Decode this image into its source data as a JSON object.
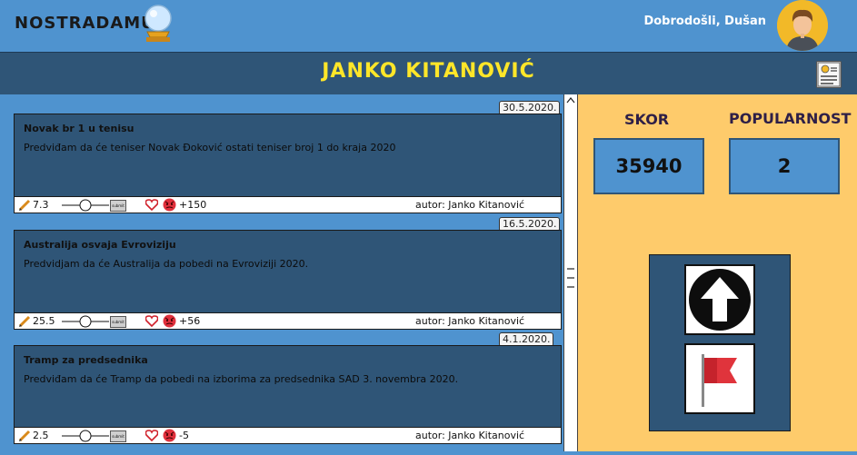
{
  "header": {
    "logo": "NOSTRADAMUS",
    "welcome": "Dobrodošli, Dušan"
  },
  "profile": {
    "name": "JANKO KITANOVIĆ"
  },
  "predictions": [
    {
      "date": "30.5.2020.",
      "title": "Novak br 1 u tenisu",
      "text": "Predviđam da će teniser Novak Đoković ostati teniser broj 1 do kraja 2020",
      "rating": "7.3",
      "vote_button": "submit",
      "score": "+150",
      "author": "autor: Janko Kitanović"
    },
    {
      "date": "16.5.2020.",
      "title": "Australija osvaja Evroviziju",
      "text": "Predvidjam da će Australija da pobedi na Evroviziji 2020.",
      "rating": "25.5",
      "vote_button": "submit",
      "score": "+56",
      "author": "autor: Janko Kitanović"
    },
    {
      "date": "4.1.2020.",
      "title": "Tramp za predsednika",
      "text": "Predviđam da će Tramp da pobedi na izborima za predsednika SAD 3. novembra 2020.",
      "rating": "2.5",
      "vote_button": "submit",
      "score": "-5",
      "author": "autor: Janko Kitanović"
    }
  ],
  "stats": {
    "score_label": "SKOR",
    "score_value": "35940",
    "popularity_label": "POPULARNOST",
    "popularity_value": "2"
  },
  "colors": {
    "background": "#4f93cf",
    "title_bar": "#2f5577",
    "title_text": "#ffe629",
    "side_panel": "#fecb6b"
  },
  "icons": [
    "crystal-ball-icon",
    "user-avatar-icon",
    "profile-document-icon",
    "pencil-icon",
    "heart-icon",
    "angry-face-icon",
    "arrow-up-icon",
    "red-flag-icon"
  ]
}
